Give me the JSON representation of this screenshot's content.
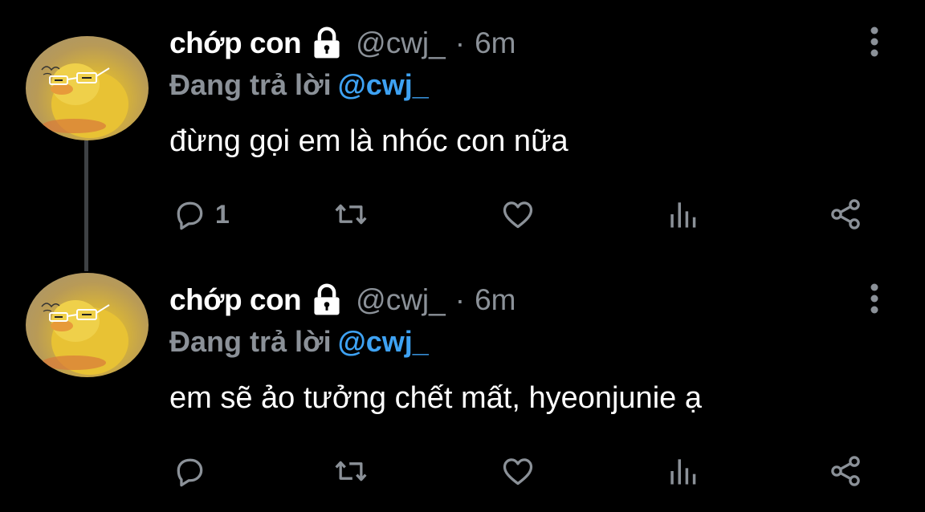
{
  "colors": {
    "background": "#000000",
    "primary_text": "#ffffff",
    "secondary_text": "#8b9198",
    "link_blue": "#3ea2f3",
    "thread_line": "#3e4144"
  },
  "tweets": [
    {
      "author": {
        "display_name": "chớp con",
        "handle": "@cwj_",
        "protected_icon": "lock-icon",
        "avatar": "yellow-duck-avatar"
      },
      "separator": "·",
      "time": "6m",
      "reply_prefix": "Đang trả lời",
      "reply_to": "@cwj_",
      "text": "đừng gọi em là nhóc con nữa",
      "reply_count": "1",
      "icons": [
        "reply-icon",
        "retweet-icon",
        "like-icon",
        "stats-icon",
        "share-icon",
        "more-icon"
      ]
    },
    {
      "author": {
        "display_name": "chớp con",
        "handle": "@cwj_",
        "protected_icon": "lock-icon",
        "avatar": "yellow-duck-avatar"
      },
      "separator": "·",
      "time": "6m",
      "reply_prefix": "Đang trả lời",
      "reply_to": "@cwj_",
      "text": "em sẽ ảo tưởng chết mất, hyeonjunie ạ",
      "reply_count": "",
      "icons": [
        "reply-icon",
        "retweet-icon",
        "like-icon",
        "stats-icon",
        "share-icon",
        "more-icon"
      ]
    }
  ]
}
